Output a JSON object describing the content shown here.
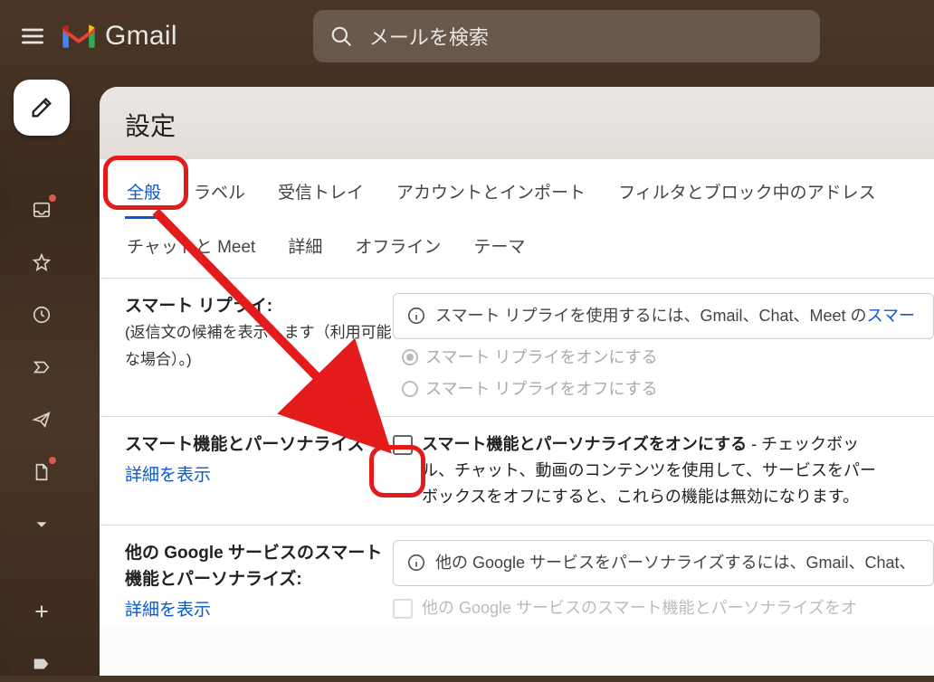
{
  "header": {
    "product": "Gmail",
    "search_placeholder": "メールを検索"
  },
  "panel": {
    "title": "設定"
  },
  "tabs": {
    "row1": [
      "全般",
      "ラベル",
      "受信トレイ",
      "アカウントとインポート",
      "フィルタとブロック中のアドレス"
    ],
    "row2": [
      "チャットと Meet",
      "詳細",
      "オフライン",
      "テーマ"
    ],
    "active": "全般"
  },
  "sections": {
    "smart_reply": {
      "title": "スマート リプライ:",
      "sub": "(返信文の候補を表示します（利用可能な場合）。)",
      "info_prefix": "スマート リプライを使用するには、Gmail、Chat、Meet の",
      "info_link": "スマー",
      "opt_on": "スマート リプライをオンにする",
      "opt_off": "スマート リプライをオフにする"
    },
    "smart_features": {
      "title": "スマート機能とパーソナライズ",
      "link": "詳細を表示",
      "check_label_bold": "スマート機能とパーソナライズをオンにする",
      "check_label_rest1": " - チェックボッ",
      "desc_line2": "ル、チャット、動画のコンテンツを使用して、サービスをパー",
      "desc_line3": "ボックスをオフにすると、これらの機能は無効になります。"
    },
    "other_google": {
      "title": "他の Google サービスのスマート機能とパーソナライズ:",
      "link": "詳細を表示",
      "info_text": "他の Google サービスをパーソナライズするには、Gmail、Chat、",
      "check_label": "他の Google サービスのスマート機能とパーソナライズをオ"
    }
  }
}
